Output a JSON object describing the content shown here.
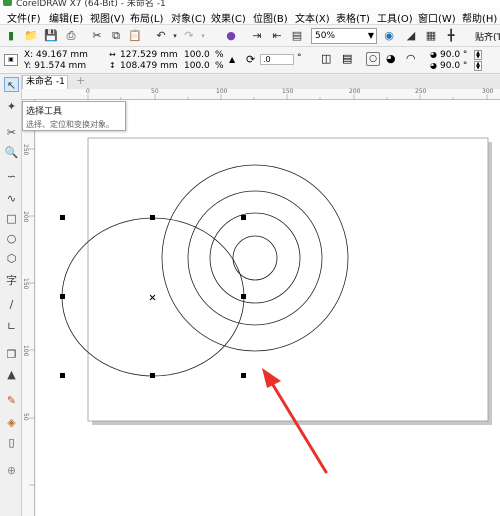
{
  "titlebar": {
    "title": "CorelDRAW X7 (64-Bit) - 未命名 -1"
  },
  "menubar": {
    "items": [
      "文件(F)",
      "编辑(E)",
      "视图(V)",
      "布局(L)",
      "对象(C)",
      "效果(C)",
      "位图(B)",
      "文本(X)",
      "表格(T)",
      "工具(O)",
      "窗口(W)",
      "帮助(H)"
    ]
  },
  "toolbar": {
    "zoom": "50%",
    "snap_label": "贴齐(T)"
  },
  "propbar": {
    "x": "X: 49.167 mm",
    "y": "Y: 91.574 mm",
    "width": "127.529 mm",
    "height": "108.479 mm",
    "scale_w": "100.0",
    "scale_h": "100.0",
    "pct": "%",
    "rotation": ".0",
    "deg": "°",
    "angle1": "90.0 °",
    "angle2": "90.0 °"
  },
  "tabs": {
    "doc": "未命名 -1",
    "add": "+"
  },
  "ruler": {
    "h_labels": [
      "0",
      "50",
      "100",
      "150",
      "200",
      "250",
      "300"
    ],
    "v_labels": [
      "250",
      "200",
      "150",
      "100",
      "50"
    ]
  },
  "tooltip": {
    "title": "选择工具",
    "desc": "选择、定位和变换对象。"
  }
}
